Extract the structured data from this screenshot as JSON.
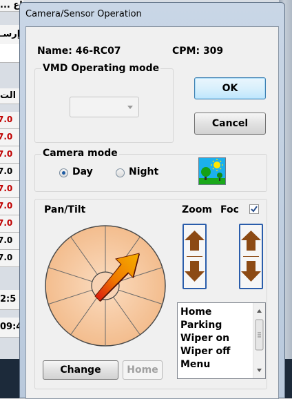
{
  "window": {
    "title": "Camera/Sensor Operation"
  },
  "header": {
    "name_label": "Name: 46-RC07",
    "cpm_label": "CPM: 309"
  },
  "vmd": {
    "label": "VMD Operating mode",
    "selected": ""
  },
  "buttons": {
    "ok": "OK",
    "cancel": "Cancel",
    "change": "Change",
    "home": "Home"
  },
  "camera_mode": {
    "label": "Camera mode",
    "options": [
      {
        "label": "Day",
        "selected": true
      },
      {
        "label": "Night",
        "selected": false
      }
    ]
  },
  "pan_tilt": {
    "label": "Pan/Tilt"
  },
  "zoom": {
    "label": "Zoom"
  },
  "focus": {
    "label": "Foc",
    "checked": true
  },
  "presets": {
    "items": [
      "Home",
      "Parking",
      "Wiper on",
      "Wiper off",
      "Menu"
    ]
  },
  "background_app": {
    "strip_texts": [
      "... اع",
      "إرسـ",
      "الت"
    ],
    "numbers": [
      "7.0",
      "7.0",
      "7.0",
      "7.0",
      "7.0",
      "7.0",
      "7.0",
      "7.0",
      "7.0"
    ],
    "number_colors": [
      "#c00000",
      "#c00000",
      "#c00000",
      "#000000",
      "#c00000",
      "#c00000",
      "#c00000",
      "#000000",
      "#000000"
    ],
    "times": [
      "2:5",
      "09:4"
    ]
  },
  "colors": {
    "dial": "#f6c79a",
    "arrow": "#e86a00",
    "accent_border": "#2a5dab"
  }
}
